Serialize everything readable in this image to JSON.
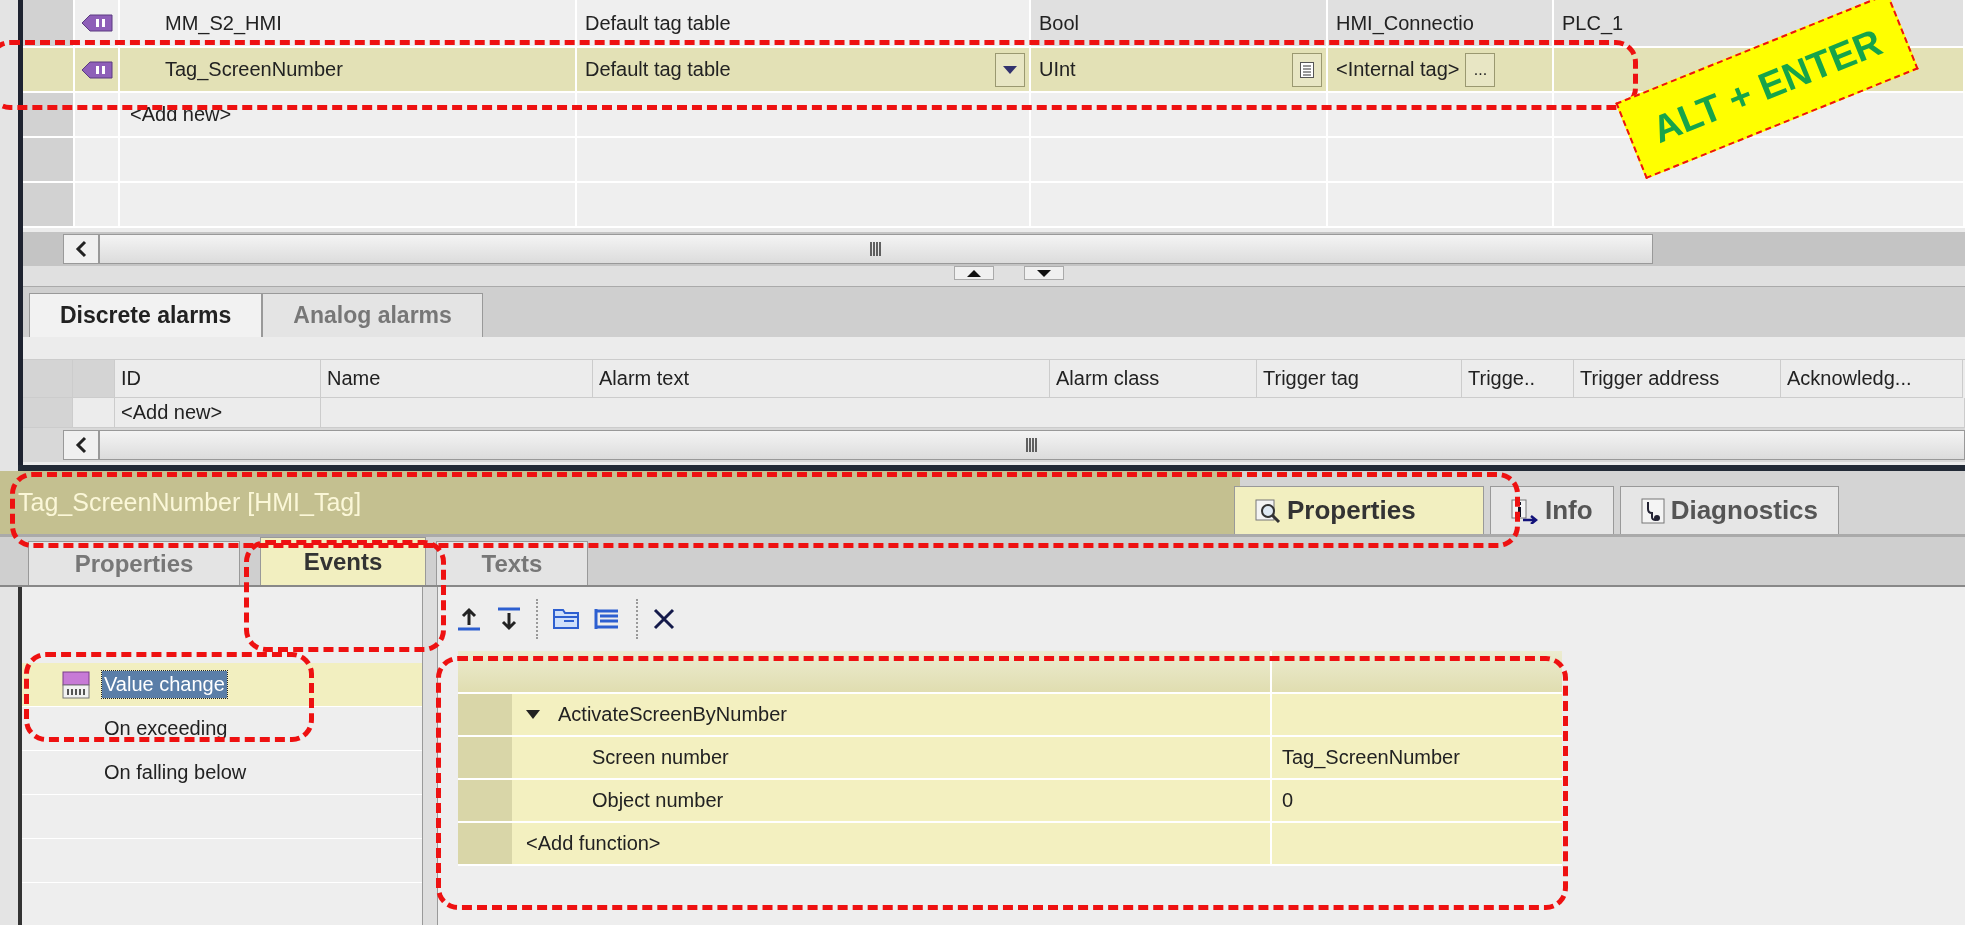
{
  "tag_table": {
    "rows": [
      {
        "name": "MM_S2_HMI",
        "tag_table": "Default tag table",
        "data_type": "Bool",
        "connection": "HMI_Connectio",
        "plc_name": "PLC_1",
        "selected": false
      },
      {
        "name": "Tag_ScreenNumber",
        "tag_table": "Default tag table",
        "data_type": "UInt",
        "connection": "<Internal tag>",
        "browse": "...",
        "selected": true
      }
    ],
    "add_new": "<Add new>"
  },
  "callout": "ALT + ENTER",
  "alarms": {
    "tabs": [
      {
        "label": "Discrete alarms",
        "selected": true
      },
      {
        "label": "Analog alarms",
        "selected": false
      }
    ],
    "columns": [
      "ID",
      "Name",
      "Alarm text",
      "Alarm class",
      "Trigger tag",
      "Trigge..",
      "Trigger address",
      "Acknowledg..."
    ],
    "add_new": "<Add new>"
  },
  "inspector": {
    "title": "Tag_ScreenNumber [HMI_Tag]",
    "tabs": [
      {
        "label": "Properties",
        "kind": "properties",
        "selected": true
      },
      {
        "label": "Info",
        "kind": "info",
        "selected": false
      },
      {
        "label": "Diagnostics",
        "kind": "diagnostics",
        "selected": false
      }
    ],
    "subtabs": [
      {
        "label": "Properties",
        "selected": false
      },
      {
        "label": "Events",
        "selected": true
      },
      {
        "label": "Texts",
        "selected": false
      }
    ],
    "events": [
      {
        "label": "Value change",
        "selected": true
      },
      {
        "label": "On exceeding",
        "selected": false
      },
      {
        "label": "On falling below",
        "selected": false
      }
    ],
    "functions": [
      {
        "name": "ActivateScreenByNumber",
        "expanded": true,
        "params": [
          {
            "name": "Screen number",
            "value": "Tag_ScreenNumber"
          },
          {
            "name": "Object number",
            "value": "0"
          }
        ]
      }
    ],
    "add_function": "<Add function>"
  }
}
